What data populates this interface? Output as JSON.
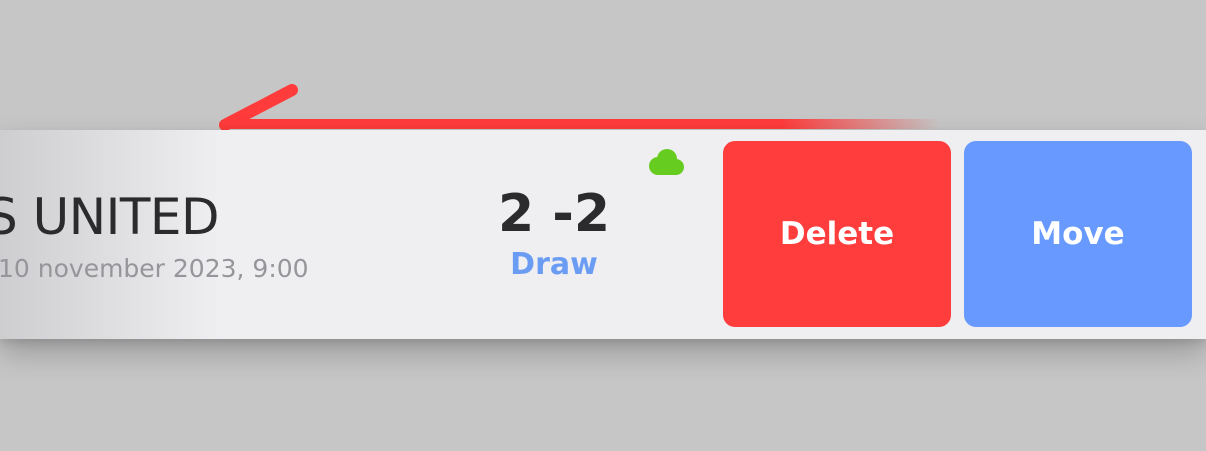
{
  "match": {
    "team": "S UNITED",
    "date": "10 november 2023, 9:00",
    "score": "2 -2",
    "result": "Draw"
  },
  "actions": {
    "delete_label": "Delete",
    "move_label": "Move"
  },
  "icons": {
    "sync": "cloud-icon",
    "swipe_hint": "swipe-left-arrow-icon"
  },
  "colors": {
    "background": "#c6c6c6",
    "card": "#efeff2",
    "delete": "#ff3d3d",
    "move": "#6799ff",
    "result": "#6a9cf3",
    "synced": "#66cc1f",
    "swipe_hint": "#ff3b3b"
  }
}
